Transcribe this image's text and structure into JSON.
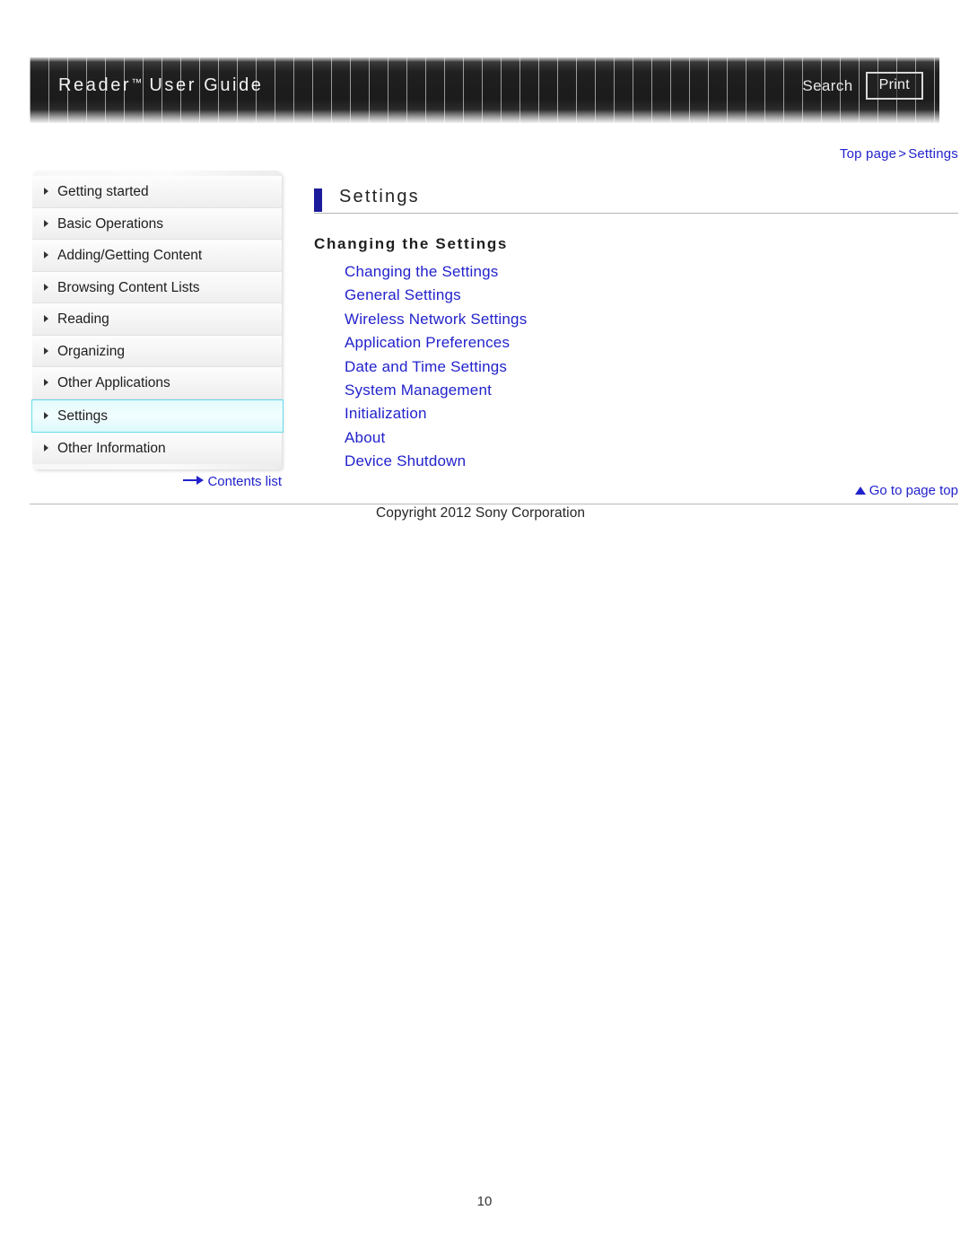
{
  "header": {
    "title": "Reader",
    "title_tm": "™",
    "title_rest": "User Guide",
    "search_label": "Search",
    "print_label": "Print"
  },
  "breadcrumb": {
    "top": "Top page",
    "separator": ">",
    "current": "Settings"
  },
  "sidebar": {
    "items": [
      {
        "label": "Getting started",
        "active": false
      },
      {
        "label": "Basic Operations",
        "active": false
      },
      {
        "label": "Adding/Getting Content",
        "active": false
      },
      {
        "label": "Browsing Content Lists",
        "active": false
      },
      {
        "label": "Reading",
        "active": false
      },
      {
        "label": "Organizing",
        "active": false
      },
      {
        "label": "Other Applications",
        "active": false
      },
      {
        "label": "Settings",
        "active": true
      },
      {
        "label": "Other Information",
        "active": false
      }
    ],
    "contents_list_label": "Contents list"
  },
  "main": {
    "page_title": "Settings",
    "section_title": "Changing the Settings",
    "links": [
      "Changing the Settings",
      "General Settings",
      "Wireless Network Settings",
      "Application Preferences",
      "Date and Time Settings",
      "System Management",
      "Initialization",
      "About",
      "Device Shutdown"
    ]
  },
  "footer": {
    "go_to_page_top": "Go to page top",
    "copyright": "Copyright 2012 Sony Corporation",
    "page_number": "10"
  },
  "colors": {
    "link_blue": "#2222cc",
    "heading_bar_navy": "#1b1b9c",
    "active_nav_cyan": "#66dced",
    "header_dark": "#1b1b1b"
  }
}
